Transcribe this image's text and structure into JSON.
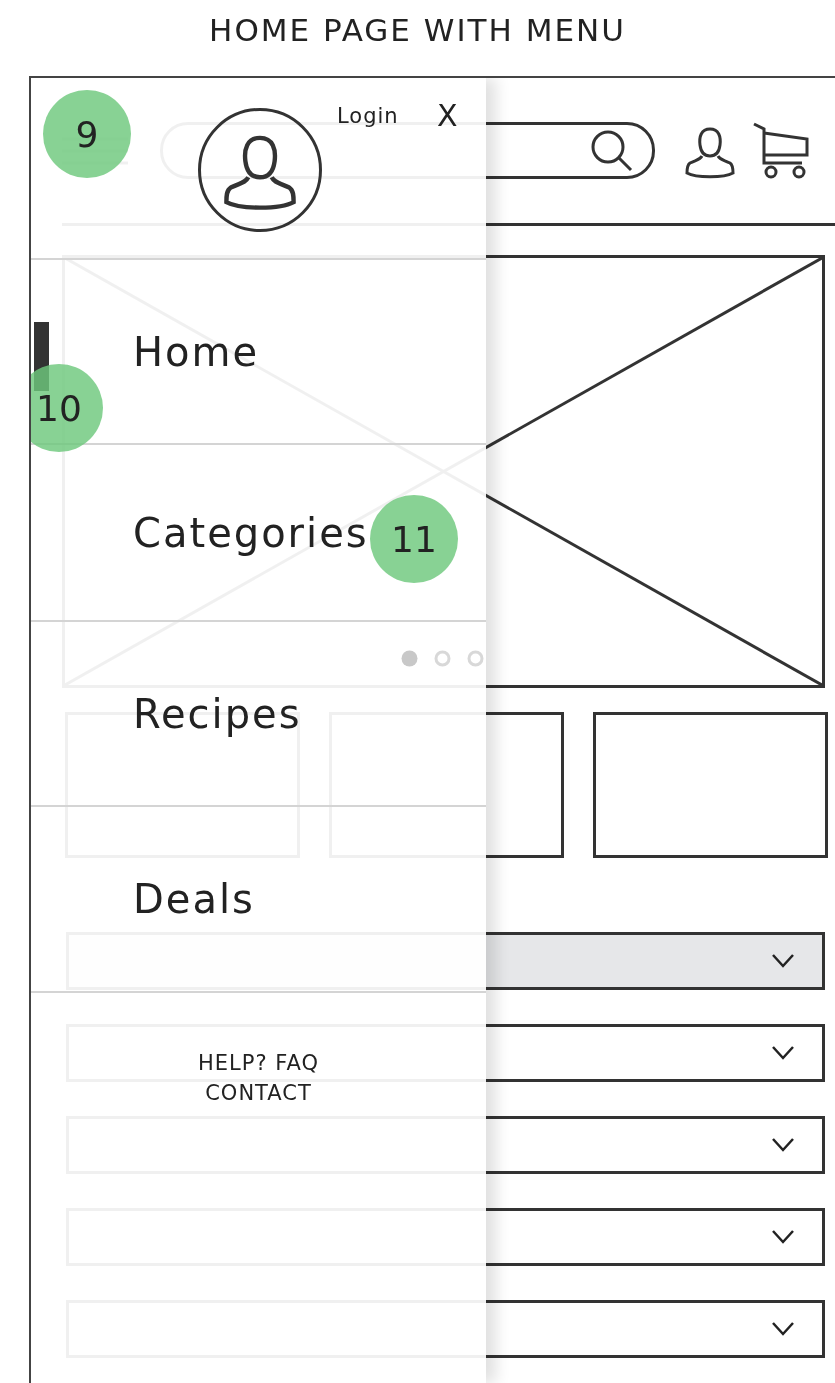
{
  "title": "HOME PAGE WITH MENU",
  "page": {
    "carousel": {
      "dots": [
        {
          "selected": true
        },
        {
          "selected": false
        },
        {
          "selected": false
        }
      ]
    },
    "categories": [
      {
        "selected": true
      },
      {
        "selected": false
      },
      {
        "selected": false
      },
      {
        "selected": false
      },
      {
        "selected": false
      }
    ]
  },
  "menu": {
    "login": "Login",
    "close": "X",
    "items": [
      {
        "label": "Home",
        "selected": true
      },
      {
        "label": "Categories",
        "selected": false
      },
      {
        "label": "Recipes",
        "selected": false
      },
      {
        "label": "Deals",
        "selected": false
      }
    ],
    "help": "HELP? FAQ",
    "contact": "CONTACT"
  },
  "annotations": [
    {
      "label": "9"
    },
    {
      "label": "10"
    },
    {
      "label": "11"
    }
  ]
}
